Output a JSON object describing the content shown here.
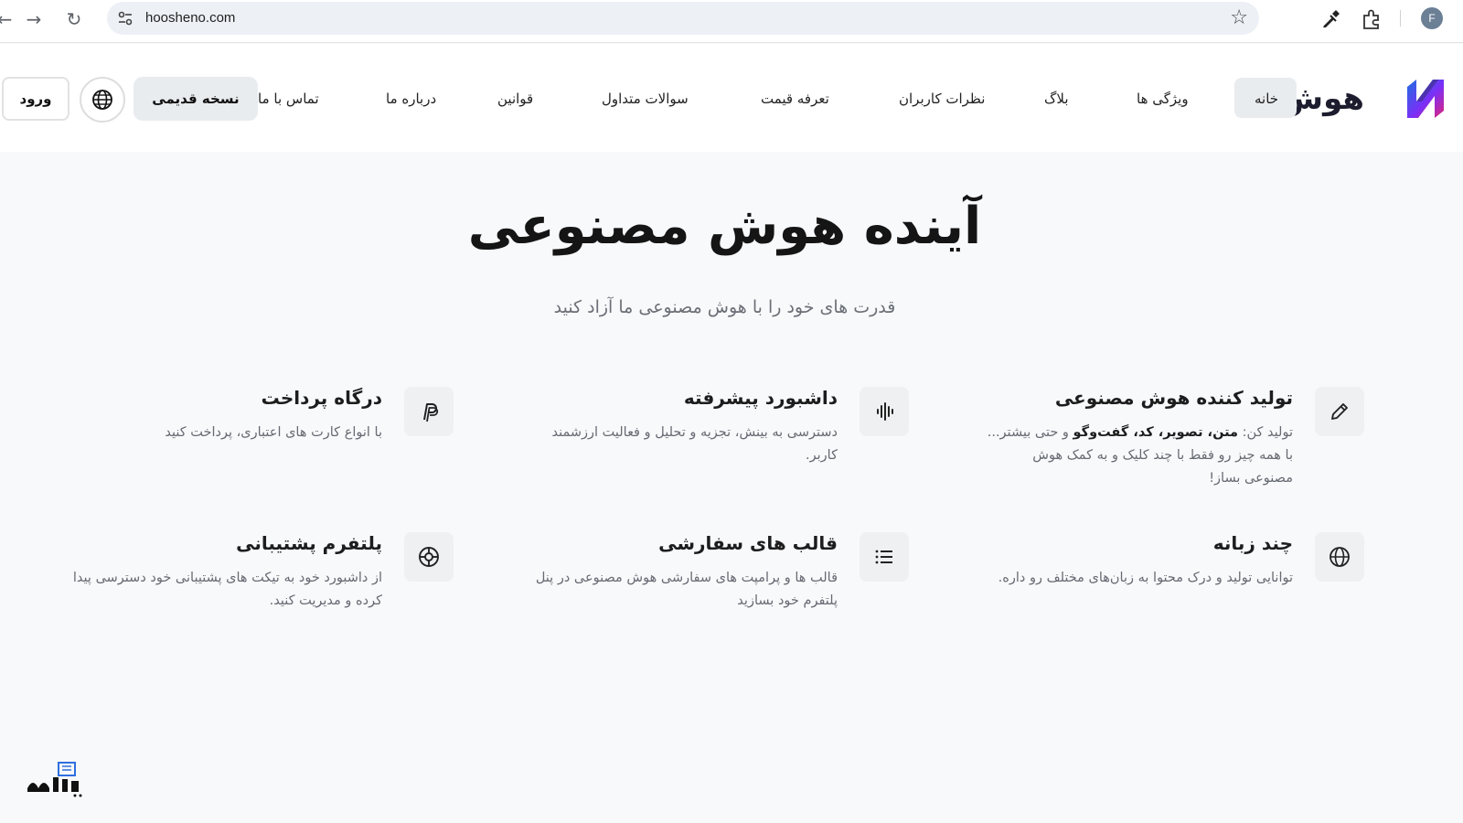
{
  "browser": {
    "url": "hoosheno.com",
    "profile_initial": "F"
  },
  "site": {
    "logo_text": "هوش نو",
    "nav": {
      "home": "خانه",
      "features": "ویژگی ها",
      "blog": "بلاگ",
      "reviews": "نظرات کاربران",
      "pricing": "تعرفه قیمت",
      "faq": "سوالات متداول",
      "rules": "قوانین",
      "about": "درباره ما",
      "contact": "تماس با ما"
    },
    "old_version": "نسخه قدیمی",
    "login": "ورود"
  },
  "hero": {
    "title": "آینده هوش مصنوعی",
    "subtitle": "قدرت های خود را با هوش مصنوعی ما آزاد کنید"
  },
  "features": [
    {
      "title": "تولید کننده هوش مصنوعی",
      "desc_prefix": "تولید کن: ",
      "desc_bold": "متن، تصویر، کد، گفت‌وگو",
      "desc_suffix": " و حتی بیشتر... با همه چیز رو فقط با چند کلیک و به کمک هوش مصنوعی بساز!",
      "icon": "pencil-icon"
    },
    {
      "title": "داشبورد پیشرفته",
      "desc": "دسترسی به بینش، تجزیه و تحلیل و فعالیت ارزشمند کاربر.",
      "icon": "waveform-icon"
    },
    {
      "title": "درگاه پرداخت",
      "desc": "با انواع کارت های اعتباری، پرداخت کنید",
      "icon": "paypal-icon"
    },
    {
      "title": "چند زبانه",
      "desc": "توانایی تولید و درک محتوا به زبان‌های مختلف رو داره.",
      "icon": "globe-icon"
    },
    {
      "title": "قالب های سفارشی",
      "desc": "قالب ها و پرامپت های سفارشی هوش مصنوعی در پنل پلتفرم خود بسازید",
      "icon": "list-icon"
    },
    {
      "title": "پلتفرم پشتیبانی",
      "desc": "از داشبورد خود به تیکت های پشتیبانی خود دسترسی پیدا کرده و مدیریت کنید.",
      "icon": "lifebuoy-icon"
    }
  ],
  "colors": {
    "accent_purple": "#7b2ff7",
    "accent_pink": "#e0247a",
    "accent_blue": "#1f6fe0",
    "button_gray": "#e9ecef"
  }
}
